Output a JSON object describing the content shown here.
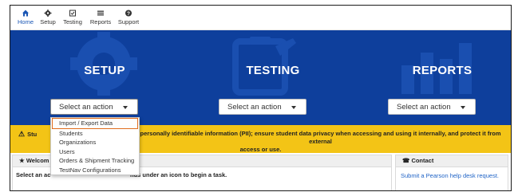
{
  "nav": {
    "items": [
      {
        "label": "Home",
        "icon": "home-icon"
      },
      {
        "label": "Setup",
        "icon": "gear-icon"
      },
      {
        "label": "Testing",
        "icon": "checklist-icon"
      },
      {
        "label": "Reports",
        "icon": "reports-icon"
      },
      {
        "label": "Support",
        "icon": "help-icon"
      }
    ]
  },
  "banner": {
    "sections": [
      {
        "title": "SETUP",
        "select_value": "Select an action"
      },
      {
        "title": "TESTING",
        "select_value": "Select an action"
      },
      {
        "title": "REPORTS",
        "select_value": "Select an action"
      }
    ]
  },
  "dropdown": {
    "options": [
      "Import / Export Data",
      "Students",
      "Organizations",
      "Users",
      "Orders & Shipment Tracking",
      "TestNav Configurations"
    ]
  },
  "warning": {
    "text_left": "Stu",
    "text_main": "personally identifiable information (PII); ensure student data privacy when accessing and using it internally, and protect it from external",
    "text_line2": "access or use."
  },
  "welcome": {
    "title": "Welcom",
    "body_left": "Select an ac",
    "body_right": "nus under an icon to begin a task."
  },
  "contact": {
    "title": "Contact",
    "link": "Submit a Pearson help desk request."
  },
  "colors": {
    "banner": "#0e3f9c",
    "warning": "#f3c416",
    "link": "#1f63c6",
    "highlight_border": "#e06c1c"
  }
}
